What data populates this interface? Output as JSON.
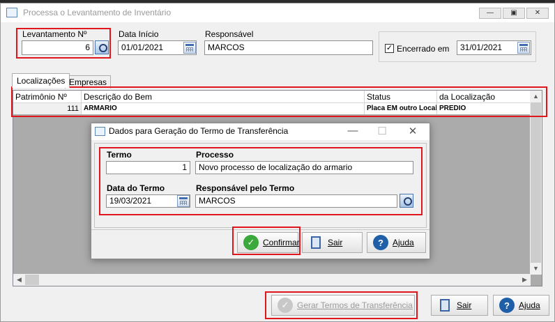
{
  "window": {
    "title": "Processa o Levantamento de Inventário",
    "minimize": "—",
    "restore": "▣",
    "close": "✕"
  },
  "form": {
    "levantamento_label": "Levantamento Nº",
    "levantamento_value": "6",
    "data_inicio_label": "Data Início",
    "data_inicio_value": "01/01/2021",
    "responsavel_label": "Responsável",
    "responsavel_value": "MARCOS",
    "encerrado_label": "Encerrado em",
    "encerrado_checked": "✓",
    "encerrado_value": "31/01/2021"
  },
  "tabs": [
    {
      "label": "Localizações"
    },
    {
      "label": "Empresas"
    }
  ],
  "grid": {
    "columns": [
      "Patrimônio Nº",
      "Descrição do Bem",
      "Status",
      "da Localização"
    ],
    "rows": [
      [
        "111",
        "ARMARIO",
        "Placa EM outro Local",
        "PREDIO"
      ]
    ]
  },
  "dialog": {
    "title": "Dados para Geração do Termo de Transferência",
    "minimize": "—",
    "maximize": "☐",
    "close": "✕",
    "termo_label": "Termo",
    "termo_value": "1",
    "processo_label": "Processo",
    "processo_value": "Novo processo de localização do armario",
    "data_termo_label": "Data do Termo",
    "data_termo_value": "19/03/2021",
    "responsavel_termo_label": "Responsável pelo Termo",
    "responsavel_termo_value": "MARCOS",
    "confirmar_label": "Confirmar",
    "sair_label": "Sair",
    "ajuda_label": "Ajuda"
  },
  "footer": {
    "gerar_label": "Gerar Termos de Transferência",
    "sair_label": "Sair",
    "ajuda_label": "Ajuda"
  },
  "colors": {
    "highlight": "#e0161c",
    "confirm_green": "#3aa83a",
    "help_blue": "#1f5fa8"
  }
}
